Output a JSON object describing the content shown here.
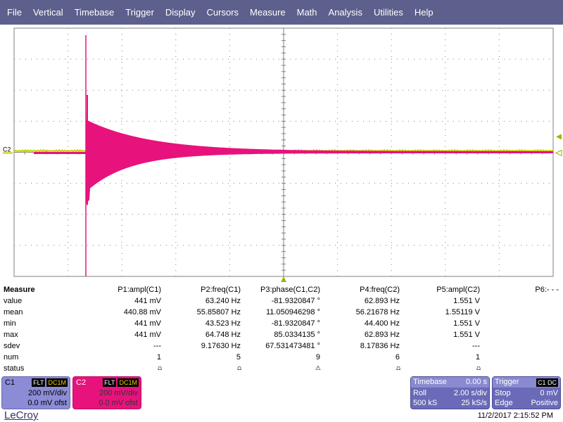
{
  "menu": [
    "File",
    "Vertical",
    "Timebase",
    "Trigger",
    "Display",
    "Cursors",
    "Measure",
    "Math",
    "Analysis",
    "Utilities",
    "Help"
  ],
  "grid": {
    "channel_label": "C2",
    "trace_colors": {
      "c1": "#c8d000",
      "c2": "#e8127c",
      "grid": "#808080",
      "trigger_marker": "#a8b000"
    }
  },
  "measure": {
    "title": "Measure",
    "columns": [
      "P1:ampl(C1)",
      "P2:freq(C1)",
      "P3:phase(C1,C2)",
      "P4:freq(C2)",
      "P5:ampl(C2)",
      "P6:- - -"
    ],
    "rows": [
      {
        "label": "value",
        "cells": [
          "441 mV",
          "63.240 Hz",
          "-81.9320847 °",
          "62.893 Hz",
          "1.551 V"
        ]
      },
      {
        "label": "mean",
        "cells": [
          "440.88 mV",
          "55.85807 Hz",
          "11.050946298 °",
          "56.21678 Hz",
          "1.55119 V"
        ]
      },
      {
        "label": "min",
        "cells": [
          "441 mV",
          "43.523 Hz",
          "-81.9320847 °",
          "44.400 Hz",
          "1.551 V"
        ]
      },
      {
        "label": "max",
        "cells": [
          "441 mV",
          "64.748 Hz",
          "85.0334135 °",
          "62.893 Hz",
          "1.551 V"
        ]
      },
      {
        "label": "sdev",
        "cells": [
          "---",
          "9.17630 Hz",
          "67.531473481 °",
          "8.17836 Hz",
          "---"
        ]
      },
      {
        "label": "num",
        "cells": [
          "1",
          "5",
          "9",
          "6",
          "1"
        ]
      },
      {
        "label": "status",
        "cells": [
          "⩍",
          "⩍",
          "⚠",
          "⩍",
          "⩍"
        ]
      }
    ]
  },
  "c1": {
    "name": "C1",
    "tags": [
      "FLT",
      "DC1M"
    ],
    "vdiv": "200 mV/div",
    "offset": "0.0 mV ofst"
  },
  "c2": {
    "name": "C2",
    "tags": [
      "FLT",
      "DC1M"
    ],
    "vdiv": "200 mV/div",
    "offset": "0.0 mV ofst"
  },
  "timebase": {
    "title": "Timebase",
    "delay": "0.00 s",
    "mode": "Roll",
    "tdiv": "2.00 s/div",
    "samples": "500 kS",
    "rate": "25 kS/s"
  },
  "trigger": {
    "title": "Trigger",
    "badge": "C1 DC",
    "state": "Stop",
    "level": "0 mV",
    "type": "Edge",
    "slope": "Positive"
  },
  "footer": {
    "brand": "LeCroy",
    "timestamp": "11/2/2017 2:15:52 PM"
  }
}
